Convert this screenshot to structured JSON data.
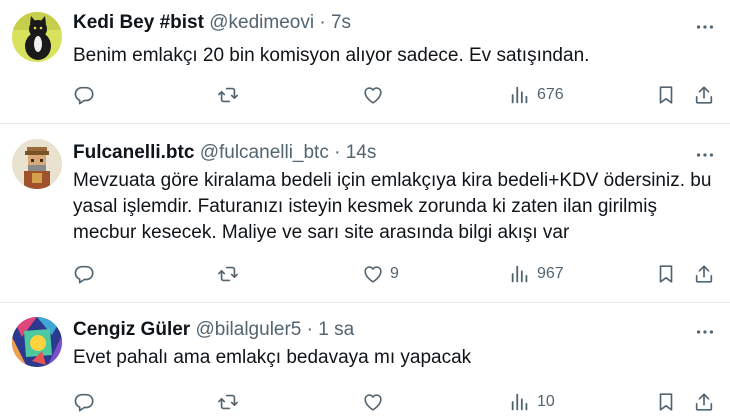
{
  "icon_color": "#536471",
  "tweets": [
    {
      "name": "Kedi Bey #bist",
      "handle": "@kedimeovi",
      "dot": "·",
      "time": "7s",
      "text": "Benim emlakçı 20 bin komisyon alıyor sadece. Ev satışından.",
      "likes": "",
      "views": "676",
      "avatar_icon": "black-cat-avatar"
    },
    {
      "name": "Fulcanelli.btc",
      "handle": "@fulcanelli_btc",
      "dot": "·",
      "time": "14s",
      "text": "Mevzuata göre kiralama bedeli için emlakçıya  kira bedeli+KDV ödersiniz. bu yasal işlemdir. Faturanızı isteyin kesmek zorunda ki zaten ilan girilmiş mecbur kesecek. Maliye ve sarı site arasında bilgi akışı var",
      "likes": "9",
      "views": "967",
      "avatar_icon": "pixel-art-character-avatar"
    },
    {
      "name": "Cengiz Güler",
      "handle": "@bilalguler5",
      "dot": "·",
      "time": "1 sa",
      "text": "Evet pahalı ama emlakçı bedavaya mı yapacak",
      "likes": "",
      "views": "10",
      "avatar_icon": "colorful-mosaic-avatar"
    }
  ]
}
